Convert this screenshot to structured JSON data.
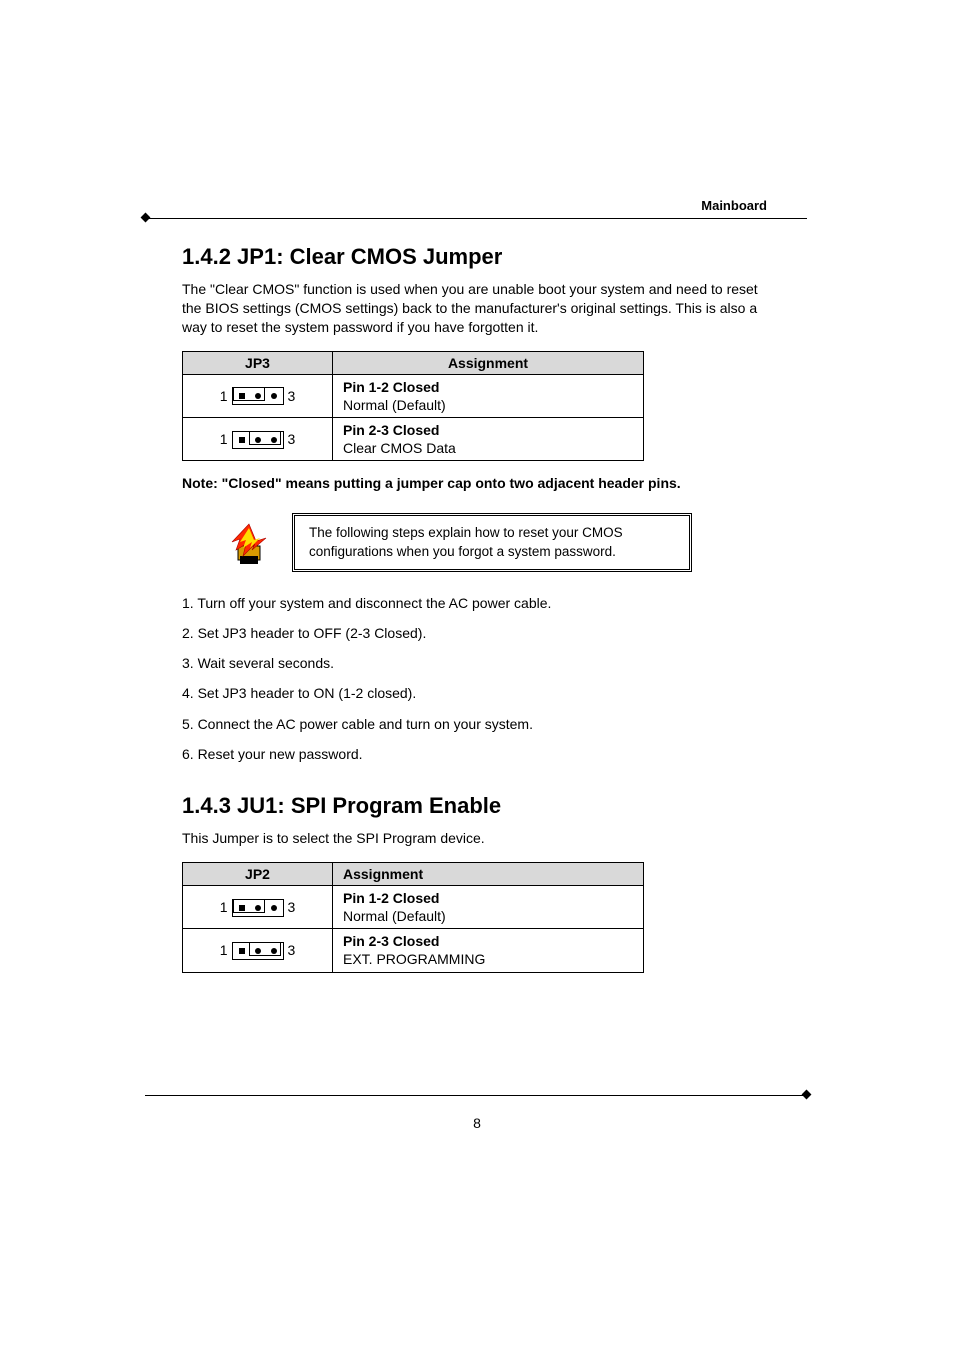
{
  "header": {
    "label": "Mainboard"
  },
  "section142": {
    "heading": "1.4.2 JP1: Clear CMOS Jumper",
    "intro": "The \"Clear CMOS\" function is used when you are unable boot your system and need to reset the BIOS settings (CMOS settings) back to the manufacturer's original settings. This is also a way to reset the system password if you have forgotten it.",
    "table": {
      "col1_header": "JP3",
      "col2_header": "Assignment",
      "rows": [
        {
          "pin_left": "1",
          "pin_right": "3",
          "closed": "12",
          "bold": "Pin 1-2 Closed",
          "norm": "Normal (Default)"
        },
        {
          "pin_left": "1",
          "pin_right": "3",
          "closed": "23",
          "bold": "Pin 2-3 Closed",
          "norm": "Clear CMOS Data"
        }
      ]
    },
    "note": "Note: \"Closed\" means putting a jumper cap onto two adjacent header pins.",
    "tip": "The following steps explain how to reset your CMOS configurations when you forgot a system password.",
    "steps": [
      "1. Turn off your system and disconnect the AC power cable.",
      "2. Set JP3 header to OFF (2-3 Closed).",
      "3. Wait several seconds.",
      "4. Set JP3 header to ON (1-2 closed).",
      "5. Connect the AC power cable and turn on your system.",
      "6. Reset your new password."
    ]
  },
  "section143": {
    "heading": "1.4.3 JU1: SPI Program Enable",
    "intro": "This Jumper is to select the SPI Program device.",
    "table": {
      "col1_header": "JP2",
      "col2_header": "Assignment",
      "rows": [
        {
          "pin_left": "1",
          "pin_right": "3",
          "closed": "12",
          "bold": "Pin 1-2 Closed",
          "norm": "Normal (Default)"
        },
        {
          "pin_left": "1",
          "pin_right": "3",
          "closed": "23",
          "bold": "Pin 2-3 Closed",
          "norm": "EXT. PROGRAMMING"
        }
      ]
    }
  },
  "footer": {
    "page_number": "8"
  }
}
